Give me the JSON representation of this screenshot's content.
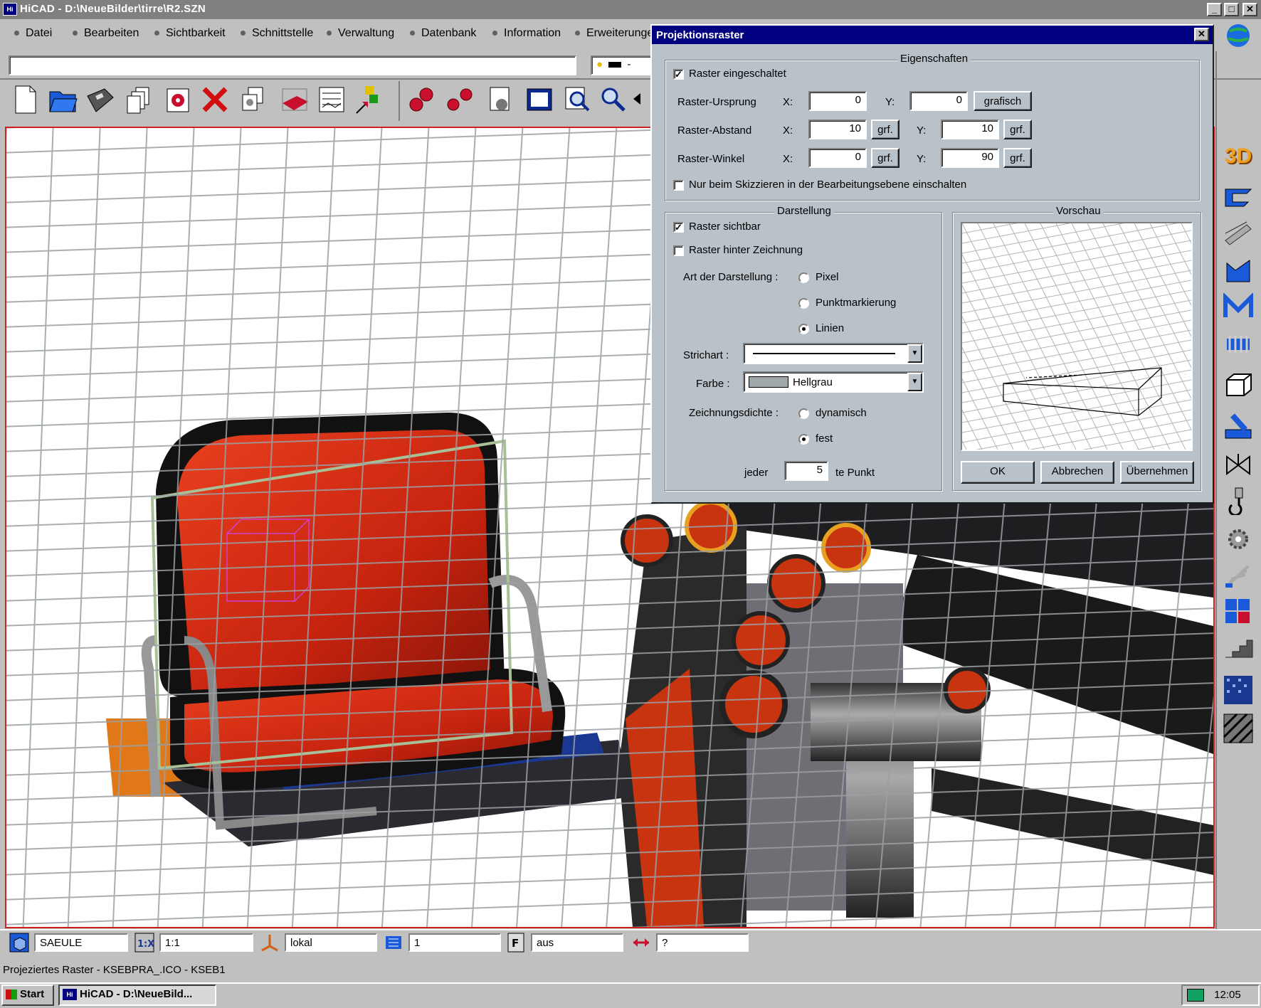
{
  "window": {
    "title": "HiCAD - D:\\NeueBilder\\tirre\\R2.SZN",
    "minimize": "_",
    "restore": "□",
    "close": "✕"
  },
  "menu": {
    "items": [
      "Datei",
      "Bearbeiten",
      "Sichtbarkeit",
      "Schnittstelle",
      "Verwaltung",
      "Datenbank",
      "Information",
      "Erweiterungen"
    ]
  },
  "command_input": {
    "value": ""
  },
  "layer_combo": {
    "value": "-"
  },
  "viewport": {
    "scene": "3d-chair-assembly-with-projected-grid",
    "frame_color": "#d02020"
  },
  "dialog": {
    "title": "Projektionsraster",
    "close": "✕",
    "eigenschaften": {
      "label": "Eigenschaften",
      "raster_on": {
        "label": "Raster eingeschaltet",
        "checked": true
      },
      "rows": [
        {
          "label": "Raster-Ursprung",
          "x_label": "X:",
          "x": "0",
          "y_label": "Y:",
          "y": "0",
          "button": "grafisch"
        },
        {
          "label": "Raster-Abstand",
          "x_label": "X:",
          "x": "10",
          "x_btn": "grf.",
          "y_label": "Y:",
          "y": "10",
          "y_btn": "grf."
        },
        {
          "label": "Raster-Winkel",
          "x_label": "X:",
          "x": "0",
          "x_btn": "grf.",
          "y_label": "Y:",
          "y": "90",
          "y_btn": "grf."
        }
      ],
      "sketch_only": {
        "label": "Nur beim Skizzieren in der Bearbeitungsebene einschalten",
        "checked": false
      }
    },
    "darstellung": {
      "label": "Darstellung",
      "visible": {
        "label": "Raster sichtbar",
        "checked": true
      },
      "behind": {
        "label": "Raster hinter Zeichnung",
        "checked": false
      },
      "art_label": "Art der Darstellung :",
      "art_options": [
        {
          "label": "Pixel",
          "selected": false
        },
        {
          "label": "Punktmarkierung",
          "selected": false
        },
        {
          "label": "Linien",
          "selected": true
        }
      ],
      "strichart_label": "Strichart :",
      "farbe_label": "Farbe :",
      "farbe_value": "Hellgrau",
      "farbe_swatch": "#a0a8ac",
      "dichte_label": "Zeichnungsdichte :",
      "dichte_options": [
        {
          "label": "dynamisch",
          "selected": false
        },
        {
          "label": "fest",
          "selected": true
        }
      ],
      "jeder_label": "jeder",
      "jeder_value": "5",
      "punkt_label": "te Punkt"
    },
    "vorschau": {
      "label": "Vorschau"
    },
    "buttons": {
      "ok": "OK",
      "cancel": "Abbrechen",
      "apply": "Übernehmen"
    }
  },
  "statusbar": {
    "fields": [
      "SAEULE",
      "1:1",
      "lokal",
      "1",
      "aus",
      "?"
    ],
    "message": "Projeziertes Raster - KSEBPRA_.ICO - KSEB1"
  },
  "taskbar": {
    "start": "Start",
    "task": "HiCAD - D:\\NeueBild...",
    "clock": "12:05"
  },
  "right_toolbar": {
    "label_3d": "3D",
    "icons": [
      "beam-icon",
      "profile-icon",
      "sheet-metal-icon",
      "m-profile-icon",
      "spring-icon",
      "box-icon",
      "pipe-icon",
      "valve-icon",
      "hook-icon",
      "gear-icon",
      "fan-icon",
      "cubes-icon",
      "stairs-icon",
      "texture-icon",
      "hatch-icon"
    ]
  },
  "colors": {
    "dialog_bg": "#b9c2c8",
    "title_active": "#000080",
    "title_inactive": "#808080",
    "seat_red": "#d42a14"
  }
}
